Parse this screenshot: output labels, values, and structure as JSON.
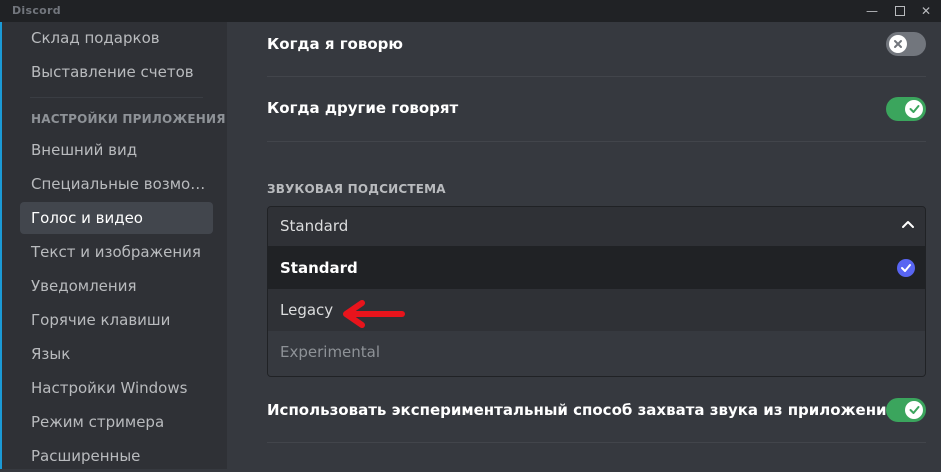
{
  "window": {
    "title": "Discord",
    "controls": {
      "minimize": "—",
      "maximize": "",
      "close": "✕"
    }
  },
  "sidebar": {
    "items_top": [
      "Склад подарков",
      "Выставление счетов"
    ],
    "section_header": "НАСТРОЙКИ ПРИЛОЖЕНИЯ",
    "items": [
      {
        "label": "Внешний вид",
        "active": false
      },
      {
        "label": "Специальные возмож...",
        "active": false
      },
      {
        "label": "Голос и видео",
        "active": true
      },
      {
        "label": "Текст и изображения",
        "active": false
      },
      {
        "label": "Уведомления",
        "active": false
      },
      {
        "label": "Горячие клавиши",
        "active": false
      },
      {
        "label": "Язык",
        "active": false
      },
      {
        "label": "Настройки Windows",
        "active": false
      },
      {
        "label": "Режим стримера",
        "active": false
      },
      {
        "label": "Расширенные",
        "active": false
      }
    ]
  },
  "main": {
    "toggle_rows": [
      {
        "label": "Когда я говорю",
        "on": false
      },
      {
        "label": "Когда другие говорят",
        "on": true
      }
    ],
    "audio_subsystem": {
      "header": "ЗВУКОВАЯ ПОДСИСТЕМА",
      "selected": "Standard",
      "options": [
        "Standard",
        "Legacy",
        "Experimental"
      ]
    },
    "experimental_capture": {
      "label": "Использовать экспериментальный способ захвата звука из приложений",
      "on": true
    }
  },
  "colors": {
    "accent": "#5865f2",
    "toggle_on": "#3ba55d",
    "toggle_off": "#72767d",
    "annotation_arrow": "#e8141c"
  }
}
